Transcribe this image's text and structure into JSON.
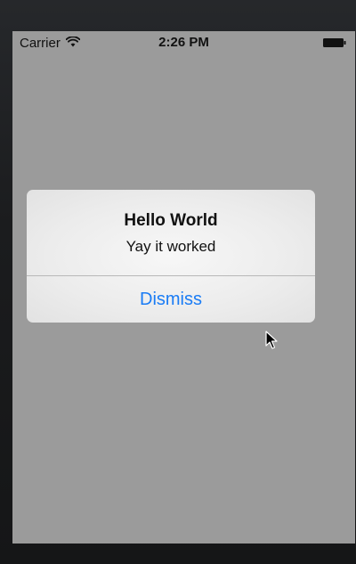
{
  "status_bar": {
    "carrier": "Carrier",
    "time": "2:26 PM",
    "wifi_icon": "wifi-icon",
    "battery_icon": "battery-icon"
  },
  "alert": {
    "title": "Hello World",
    "message": "Yay it worked",
    "dismiss_label": "Dismiss"
  },
  "colors": {
    "accent": "#1a7cf5",
    "dim_background": "#9b9b9b",
    "device_frame": "#1c1d1f"
  }
}
